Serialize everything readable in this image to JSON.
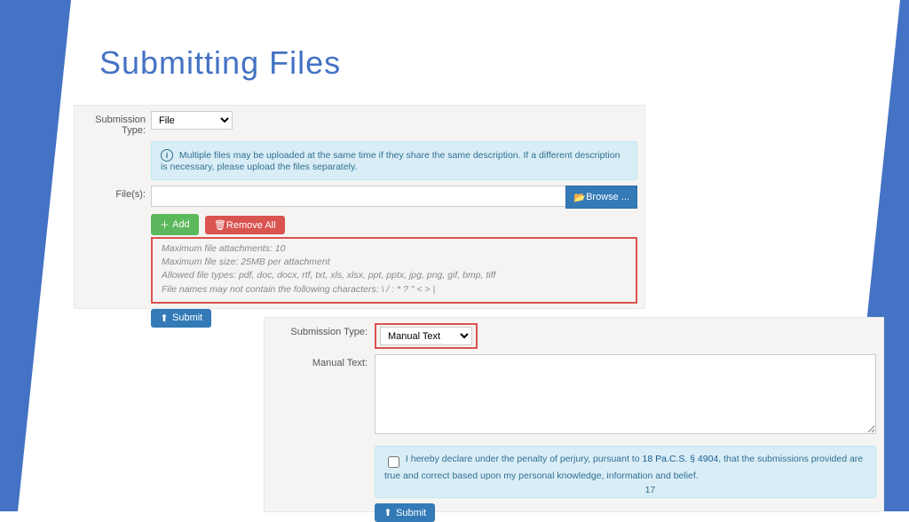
{
  "slide": {
    "title": "Submitting Files"
  },
  "panel1": {
    "labelSubmissionType": "Submission Type:",
    "submissionTypeValue": "File",
    "info": "Multiple files may be uploaded at the same time if they share the same description. If a different description is necessary, please upload the files separately.",
    "labelFiles": "File(s):",
    "browse": "Browse ...",
    "add": "Add",
    "removeAll": "Remove All",
    "hints": {
      "l1": "Maximum file attachments: 10",
      "l2": "Maximum file size: 25MB per attachment",
      "l3": "Allowed file types: pdf, doc, docx, rtf, txt, xls, xlsx, ppt, pptx, jpg, png, gif, bmp, tiff",
      "l4": "File names may not contain the following characters:  \\ / : * ? \" < > |"
    },
    "submit": "Submit"
  },
  "panel2": {
    "labelSubmissionType": "Submission Type:",
    "submissionTypeValue": "Manual Text",
    "labelManualText": "Manual Text:",
    "declarePrefix": "I hereby declare under the penalty of perjury, pursuant to ",
    "declareLinkText": "18 Pa.C.S. § 4904",
    "declareSuffix": ", that the submissions provided are true and correct based upon my personal knowledge, information and belief.",
    "pageNumber": "17",
    "submit": "Submit"
  }
}
